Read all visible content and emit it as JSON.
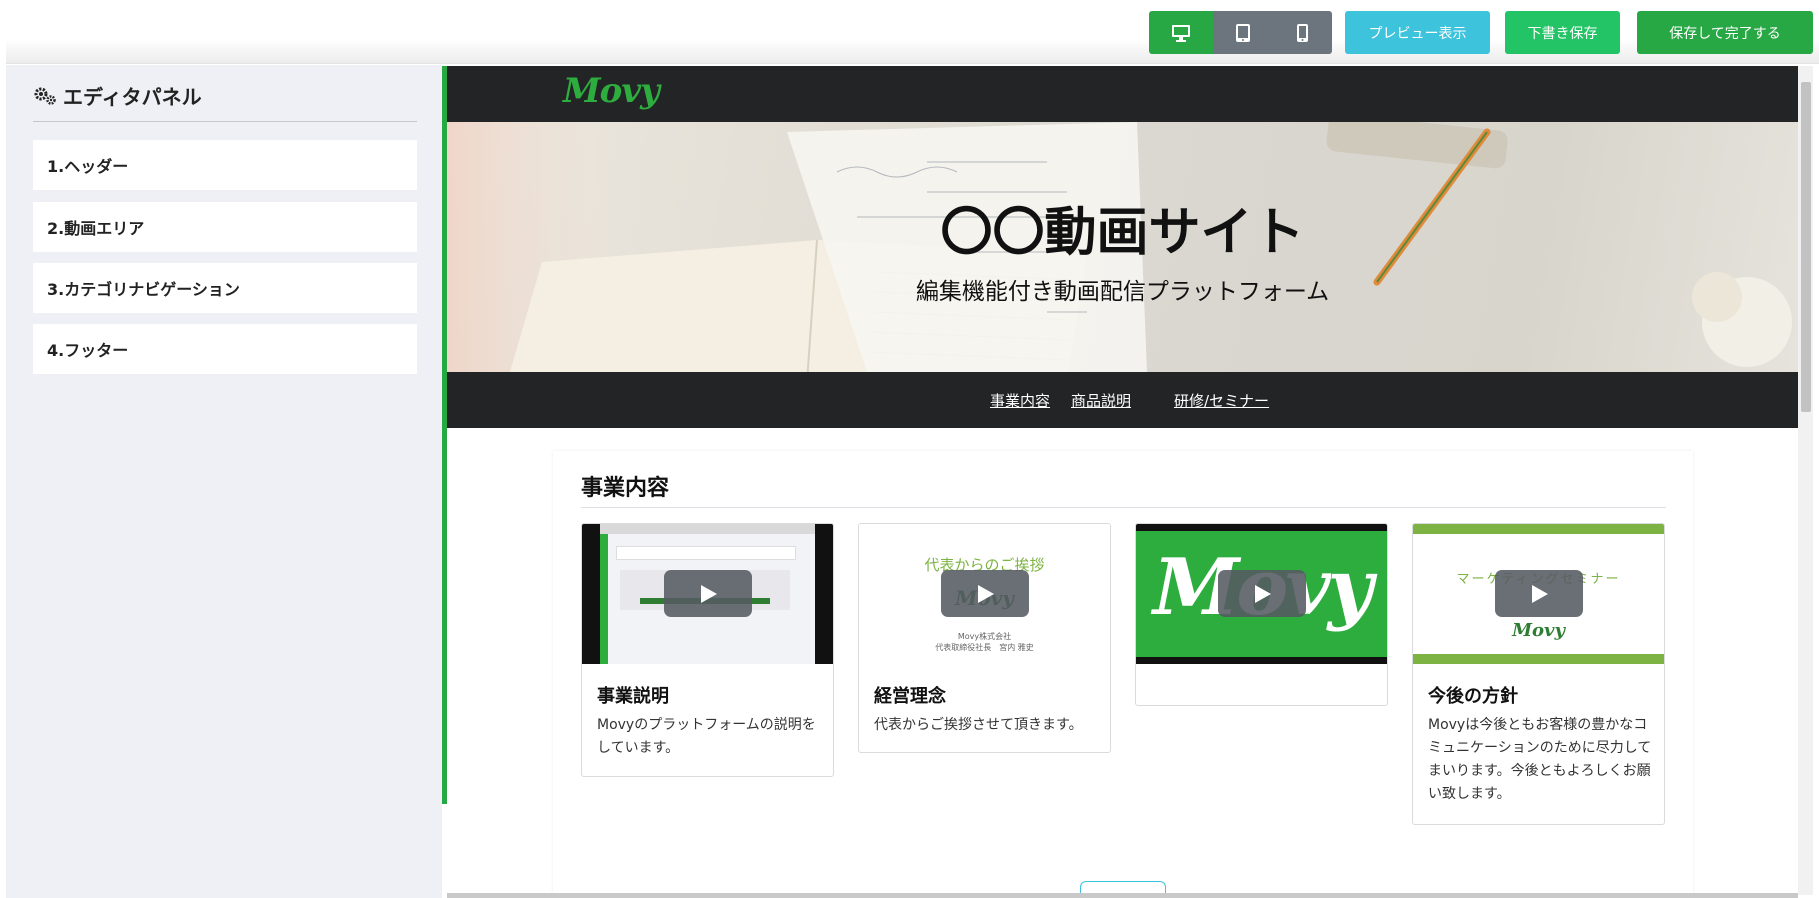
{
  "toolbar": {
    "device_buttons": {
      "desktop": "desktop-icon",
      "tablet": "tablet-icon",
      "phone": "phone-icon"
    },
    "preview_label": "プレビュー表示",
    "draft_label": "下書き保存",
    "finish_label": "保存して完了する",
    "colors": {
      "green": "#28a745",
      "gray": "#6c757d",
      "cyan": "#3ec3dc",
      "light_green": "#22c466"
    }
  },
  "editor": {
    "title": "エディタパネル",
    "title_icon": "gears-icon",
    "items": [
      {
        "label": "1.ヘッダー"
      },
      {
        "label": "2.動画エリア"
      },
      {
        "label": "3.カテゴリナビゲーション"
      },
      {
        "label": "4.フッター"
      }
    ]
  },
  "site": {
    "logo": "Movy",
    "hero_title": "〇〇動画サイト",
    "hero_subtitle": "編集機能付き動画配信プラットフォーム",
    "nav": [
      "事業内容",
      "商品説明",
      "研修/セミナー"
    ],
    "section_title": "事業内容",
    "cards": [
      {
        "title": "事業説明",
        "desc": "Movyのプラットフォームの説明をしています。"
      },
      {
        "title": "経営理念",
        "desc": "代表からご挨拶させて頂きます。",
        "thumb_heading": "代表からのご挨拶",
        "thumb_logo": "Movy",
        "thumb_company": "Movy株式会社",
        "thumb_person": "代表取締役社長　宮内 雅史"
      },
      {
        "title": "",
        "desc": "",
        "thumb_logo": "Movy"
      },
      {
        "title": "今後の方針",
        "desc": "Movyは今後ともお客様の豊かなコミュニケーションのために尽力してまいります。今後ともよろしくお願い致します。",
        "thumb_heading": "マーケティングセミナー",
        "thumb_logo": "Movy"
      }
    ]
  }
}
